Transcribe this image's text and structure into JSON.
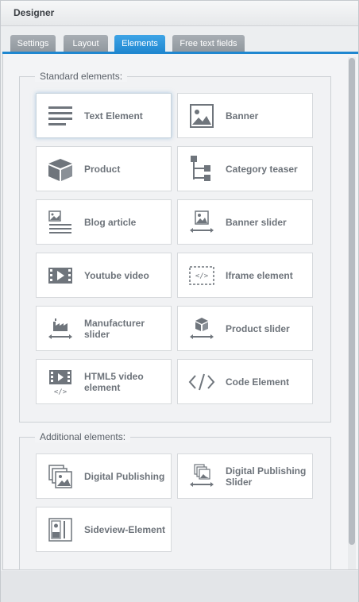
{
  "window": {
    "title": "Designer"
  },
  "tabs": [
    {
      "label": "Settings",
      "active": false
    },
    {
      "label": "Layout",
      "active": false
    },
    {
      "label": "Elements",
      "active": true
    },
    {
      "label": "Free text fields",
      "active": false
    }
  ],
  "standard": {
    "legend": "Standard elements:",
    "tiles": [
      {
        "label": "Text Element",
        "icon": "text-lines-icon"
      },
      {
        "label": "Banner",
        "icon": "image-icon"
      },
      {
        "label": "Product",
        "icon": "box-icon"
      },
      {
        "label": "Category teaser",
        "icon": "tree-icon"
      },
      {
        "label": "Blog article",
        "icon": "article-icon"
      },
      {
        "label": "Banner slider",
        "icon": "image-slider-icon"
      },
      {
        "label": "Youtube video",
        "icon": "video-icon"
      },
      {
        "label": "Iframe element",
        "icon": "iframe-icon"
      },
      {
        "label": "Manufacturer slider",
        "icon": "factory-slider-icon"
      },
      {
        "label": "Product slider",
        "icon": "box-slider-icon"
      },
      {
        "label": "HTML5 video element",
        "icon": "html5-video-icon"
      },
      {
        "label": "Code Element",
        "icon": "code-icon"
      }
    ]
  },
  "additional": {
    "legend": "Additional elements:",
    "tiles": [
      {
        "label": "Digital Publishing",
        "icon": "stacked-images-icon"
      },
      {
        "label": "Digital Publishing Slider",
        "icon": "stacked-images-slider-icon"
      },
      {
        "label": "Sideview-Element",
        "icon": "sideview-icon"
      }
    ]
  },
  "colors": {
    "accent": "#1f87d0",
    "icon": "#6f757c",
    "tile_text": "#6d737a"
  }
}
